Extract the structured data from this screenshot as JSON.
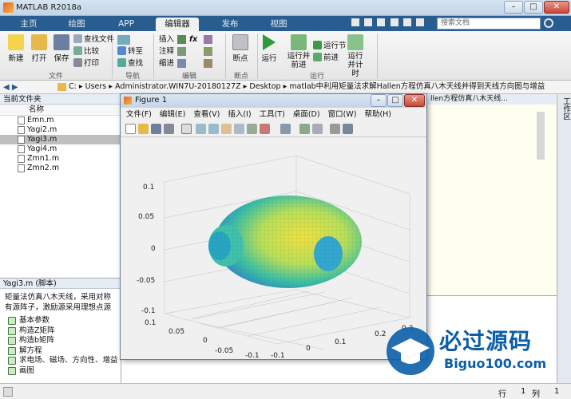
{
  "window": {
    "title": "MATLAB R2018a",
    "controls": [
      "–",
      "□",
      "✕"
    ]
  },
  "tabs": [
    {
      "label": "主页"
    },
    {
      "label": "绘图"
    },
    {
      "label": "APP"
    },
    {
      "label": "编辑器"
    },
    {
      "label": "发布"
    },
    {
      "label": "视图"
    }
  ],
  "search": {
    "placeholder": "搜索文档"
  },
  "ribbon": {
    "file": {
      "new": "新建",
      "open": "打开",
      "save": "保存",
      "find_files": "查找文件",
      "compare": "比较",
      "print": "打印",
      "group": "文件"
    },
    "nav": {
      "go_to": "转至",
      "find": "查找",
      "group": "导航"
    },
    "edit": {
      "insert": "插入",
      "comment": "注释",
      "indent": "缩进",
      "fx": "fx",
      "group": "编辑"
    },
    "breakpoints": {
      "breakpoint": "断点",
      "group": "断点"
    },
    "run": {
      "run": "运行",
      "run_advance": "运行并前进",
      "run_section": "运行节",
      "advance": "前进",
      "run_time": "运行并计时",
      "group": "运行"
    }
  },
  "address": {
    "path": [
      "C:",
      "Users",
      "Administrator.WIN7U-20180127Z",
      "Desktop",
      "matlab中利用矩量法求解Hallen方程仿真八木天线并得到天线方向图与增益"
    ]
  },
  "file_panel": {
    "title": "当前文件夹",
    "column": "名称",
    "files": [
      "Emn.m",
      "Yagi2.m",
      "Yagi3.m",
      "Yagi4.m",
      "Zmn1.m",
      "Zmn2.m"
    ],
    "selected": "Yagi3.m"
  },
  "details": {
    "title": "Yagi3.m  (脚本)",
    "description": "矩量法仿真八木天线，采用对称有源阵子，激励源采用理想点源",
    "sections": [
      "基本参数",
      "构造Z矩阵",
      "构造b矩阵",
      "解方程",
      "求电场、磁场、方向性、增益",
      "画图"
    ]
  },
  "editor_tab_text": "llen方程仿真八木天线...",
  "right_strip_label": "工作区",
  "status": {
    "row_label": "行",
    "row": "1",
    "col_label": "列",
    "col": "1"
  },
  "figure": {
    "title": "Figure 1",
    "menu": [
      "文件(F)",
      "编辑(E)",
      "查看(V)",
      "插入(I)",
      "工具(T)",
      "桌面(D)",
      "窗口(W)",
      "帮助(H)"
    ],
    "axes": {
      "z_ticks": [
        "0.1",
        "0.05",
        "0",
        "-0.05",
        "-0.1"
      ],
      "x_ticks": [
        "0.1",
        "0.05",
        "0",
        "-0.05",
        "-0.1"
      ],
      "y_ticks": [
        "0.3",
        "0.2",
        "0.1",
        "0",
        "-0.1"
      ]
    }
  },
  "watermark": {
    "cn": "必过源码",
    "en": "Biguo100.com"
  }
}
